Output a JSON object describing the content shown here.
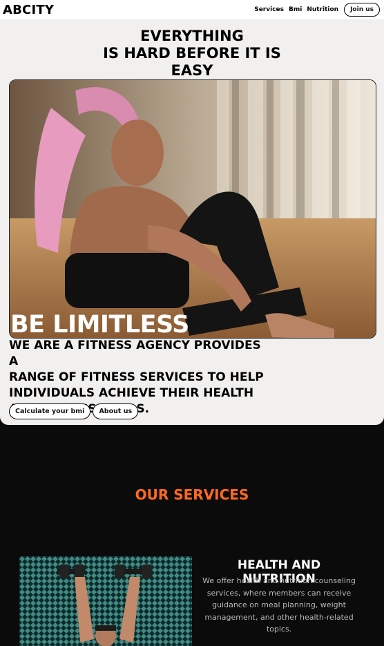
{
  "nav": {
    "brand": "ABCITY",
    "links": [
      "Services",
      "Bmi",
      "Nutrition"
    ],
    "join_label": "Join us"
  },
  "hero": {
    "title_lines": [
      "EVERYTHING",
      "IS HARD BEFORE IT IS",
      "EASY"
    ],
    "image_caption": "BE LIMITLESS",
    "description_lines": [
      "WE ARE A FITNESS AGENCY PROVIDES A",
      "RANGE OF FITNESS SERVICES TO HELP",
      "INDIVIDUALS ACHIEVE THEIR HEALTH",
      "AND FITNESS GOALS."
    ],
    "buttons": [
      "Calculate your bmi",
      "About us"
    ]
  },
  "services": {
    "title": "OUR SERVICES",
    "items": [
      {
        "heading": "HEALTH AND NUTRITION",
        "text": "We offer health and nutrition counseling services, where members can receive guidance on meal planning, weight management, and other health-related topics."
      }
    ]
  },
  "colors": {
    "accent": "#ff6a1f",
    "hero_bg": "#f1f0ef",
    "dark_bg": "#0b0b0b"
  }
}
